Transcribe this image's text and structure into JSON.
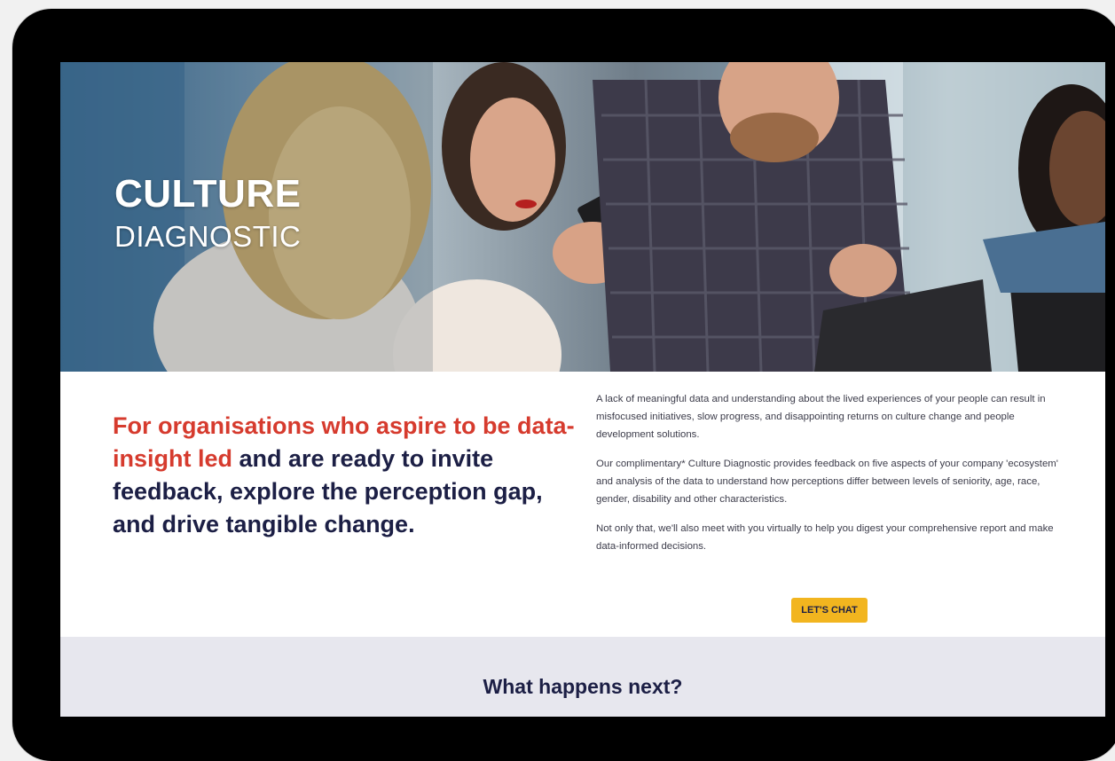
{
  "hero": {
    "title": "CULTURE",
    "subtitle": "DIAGNOSTIC"
  },
  "intro": {
    "headline_accent": "For organisations who aspire to be data-insight led",
    "headline_rest": " and are ready to invite feedback, explore the perception gap, and drive tangible change.",
    "paragraphs": [
      "A lack of meaningful data and understanding about the lived experiences of your people can result in misfocused initiatives, slow progress, and disappointing returns on culture change and people development solutions.",
      "Our complimentary* Culture Diagnostic provides feedback on five aspects of your company 'ecosystem' and analysis of the data to understand how perceptions differ between levels of seniority, age, race, gender, disability and other characteristics.",
      "Not only that, we'll also meet with you virtually to help you digest your comprehensive report and make data-informed decisions."
    ],
    "cta_label": "LET'S CHAT"
  },
  "next": {
    "title": "What happens next?"
  },
  "colors": {
    "accent": "#d63b2e",
    "navy": "#1c1f45",
    "cta": "#f2b51f",
    "section_bg": "#e7e7ee"
  }
}
